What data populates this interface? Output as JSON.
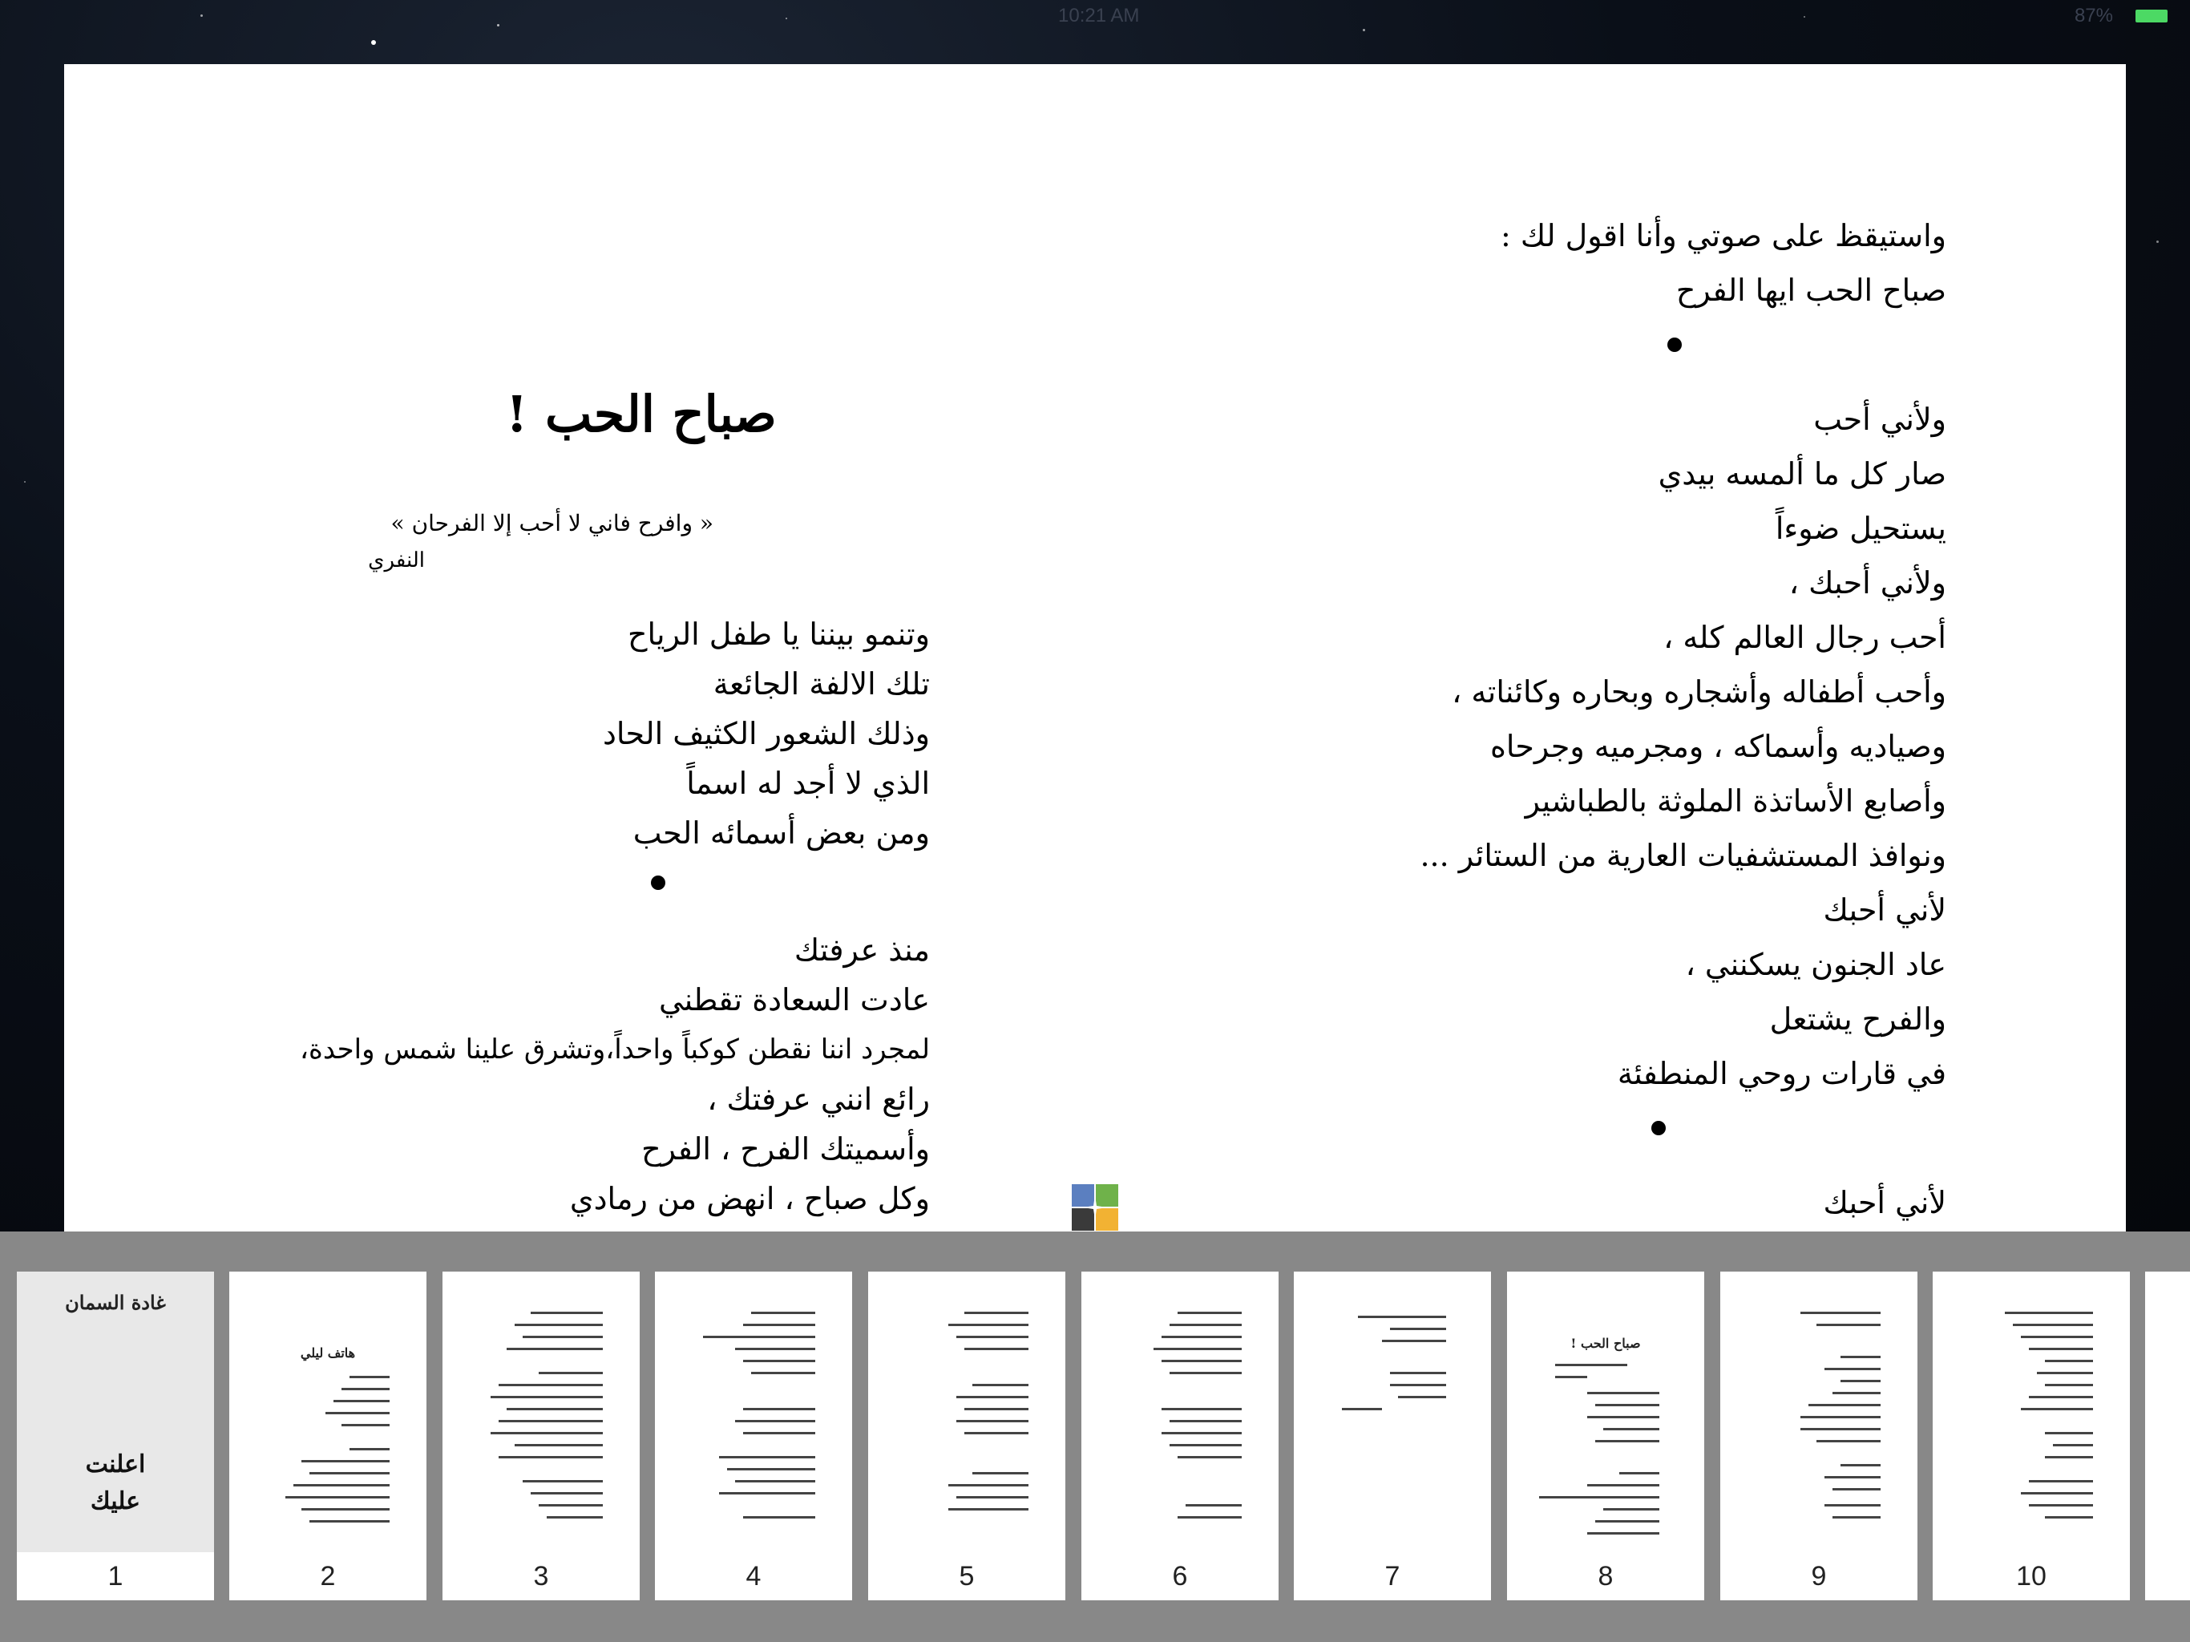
{
  "status_bar": {
    "time": "10:21 AM",
    "battery": "87%"
  },
  "reader": {
    "right_page_lines": [
      "واستيقظ على صوتي وأنا اقول لك :",
      "صباح الحب ايها الفرح",
      "",
      "ولأني أحب",
      "صار كل ما ألمسه بيدي",
      "يستحيل ضوءاً",
      "ولأني أحبك ،",
      "أحب رجال العالم كله ،",
      "وأحب أطفاله وأشجاره وبحاره وكائناته ،",
      "وصياديه وأسماكه ، ومجرميه وجرحاه",
      "وأصابع الأساتذة الملوثة بالطباشير",
      "ونوافذ المستشفيات العارية من الستائر ...",
      "لأني أحبك",
      "عاد الجنون يسكنني ،",
      "والفرح يشتعل",
      "في قارات روحي المنطفئة",
      "",
      "لأني أحبك"
    ],
    "poem_title": "صباح الحب !",
    "epigraph": "« وافرح فاني لا أحب إلا الفرحان »",
    "epigraph_author": "النفري",
    "left_page_lines": [
      "وتنمو بيننا يا طفل الرياح",
      "تلك الالفة الجائعة",
      "وذلك الشعور الكثيف الحاد",
      "الذي لا أجد له اسماً",
      "ومن بعض أسمائه الحب",
      "",
      "منذ عرفتك",
      "عادت السعادة تقطني",
      "لمجرد اننا نقطن كوكباً واحداً،وتشرق علينا شمس واحدة،",
      "رائع انني عرفتك ،",
      "وأسميتك الفرح ، الفرح",
      "وكل صباح ، انهض من رمادي"
    ]
  },
  "app_logo": {
    "name": "app-logo-icon",
    "colors": [
      "#5b7fc0",
      "#6fb24a",
      "#3a3a3a",
      "#f2b233"
    ]
  },
  "thumbnails": {
    "selected_page": "1",
    "pages": [
      {
        "number": "1",
        "title": "غادة السمان",
        "author_line1": "اعلنت",
        "author_line2": "عليك"
      },
      {
        "number": "2",
        "heading": "هاتف ليلي"
      },
      {
        "number": "3"
      },
      {
        "number": "4"
      },
      {
        "number": "5"
      },
      {
        "number": "6"
      },
      {
        "number": "7"
      },
      {
        "number": "8",
        "heading": "صباح الحب !"
      },
      {
        "number": "9"
      },
      {
        "number": "10"
      }
    ]
  }
}
